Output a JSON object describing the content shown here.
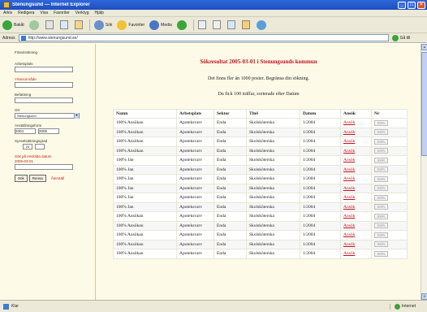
{
  "window": {
    "title": "Stenungsund — Internet Explorer"
  },
  "menubar": {
    "items": [
      "Arkiv",
      "Redigera",
      "Visa",
      "Favoriter",
      "Verktyg",
      "Hjälp"
    ]
  },
  "toolbar": {
    "back": "Bakåt",
    "search": "Sök",
    "favorites": "Favoriter",
    "media": "Media"
  },
  "address": {
    "label": "Adress",
    "url": "http://www.stenungsund.se/",
    "go": "Gå till"
  },
  "sidebar": {
    "f1_label": "Fritextsökning",
    "f2_label": "Arbetsplats",
    "f3_label": "Yrkesområde",
    "f4_label": "Befattning",
    "f5_label": "Ort",
    "f5_value": "Stenungsund",
    "f6_label": "Anställningsform",
    "f6_from": "2004",
    "f6_to": "2005",
    "f7_label": "Sysselsättningsgrad",
    "f7_value": "20",
    "f8_label": "Sök på enskilda datum",
    "f8_value": "2005-03-01",
    "btn_search": "Sök",
    "btn_clear": "Rensa",
    "reset_link": "Återställ"
  },
  "main": {
    "heading": "Sökresultat 2005-03-01 i Stenungsunds kommun",
    "line1": "Det finns fler än 1000 poster. Begränsa din sökning.",
    "line2": "Du fick 100 träffar, sorterade efter Datum"
  },
  "table": {
    "headers": [
      "Namn",
      "Arbetsplats",
      "Sektor",
      "Titel",
      "Datum",
      "Ansök",
      "Nr"
    ],
    "rows": [
      [
        "100% Ansökan",
        "Apoteksvarv",
        "Enda",
        "Skolsköterska",
        "1/2004",
        "Ansök",
        "100%"
      ],
      [
        "100% Ansökan",
        "Apoteksvarv",
        "Enda",
        "Skolsköterska",
        "1/2004",
        "Ansök",
        "100%"
      ],
      [
        "100% Ansökan",
        "Apoteksvarv",
        "Enda",
        "Skolsköterska",
        "1/2004",
        "Ansök",
        "100%"
      ],
      [
        "100% Ansökan",
        "Apoteksvarv",
        "Enda",
        "Skolsköterska",
        "1/2004",
        "Ansök",
        "100%"
      ],
      [
        "100% Jan",
        "Apoteksvarv",
        "Enda",
        "Skolsköterska",
        "1/2004",
        "Ansök",
        "100%"
      ],
      [
        "100% Jan",
        "Apoteksvarv",
        "Enda",
        "Skolsköterska",
        "1/2004",
        "Ansök",
        "100%"
      ],
      [
        "100% Jan",
        "Apoteksvarv",
        "Enda",
        "Skolsköterska",
        "1/2004",
        "Ansök",
        "100%"
      ],
      [
        "100% Jan",
        "Apoteksvarv",
        "Enda",
        "Skolsköterska",
        "1/2004",
        "Ansök",
        "100%"
      ],
      [
        "100% Jan",
        "Apoteksvarv",
        "Enda",
        "Skolsköterska",
        "1/2004",
        "Ansök",
        "100%"
      ],
      [
        "100% Jan",
        "Apoteksvarv",
        "Enda",
        "Skolsköterska",
        "1/2004",
        "Ansök",
        "100%"
      ],
      [
        "100% Ansökan",
        "Apoteksvarv",
        "Enda",
        "Skolsköterska",
        "1/2004",
        "Ansök",
        "100%"
      ],
      [
        "100% Ansökan",
        "Apoteksvarv",
        "Enda",
        "Skolsköterska",
        "1/2004",
        "Ansök",
        "100%"
      ],
      [
        "100% Ansökan",
        "Apoteksvarv",
        "Enda",
        "Skolsköterska",
        "1/2004",
        "Ansök",
        "100%"
      ],
      [
        "100% Ansökan",
        "Apoteksvarv",
        "Enda",
        "Skolsköterska",
        "1/2004",
        "Ansök",
        "100%"
      ],
      [
        "100% Ansökan",
        "Apoteksvarv",
        "Enda",
        "Skolsköterska",
        "1/2004",
        "Ansök",
        "100%"
      ]
    ]
  },
  "status": {
    "text": "Klar",
    "zone": "Internet"
  },
  "colors": {
    "accent_red": "#c0141e",
    "titlebar_blue": "#1c4fbf",
    "page_bg": "#fdfbe8"
  }
}
